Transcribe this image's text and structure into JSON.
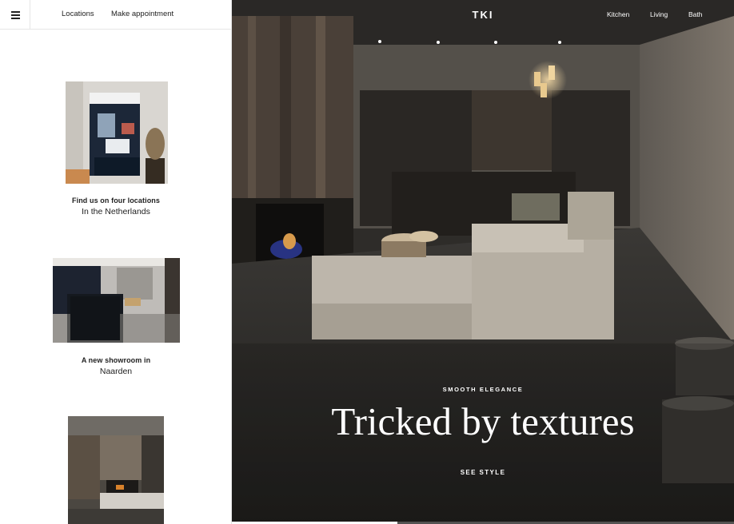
{
  "topbar": {
    "menu_icon": "hamburger-menu-icon",
    "links": [
      "Locations",
      "Make appointment"
    ]
  },
  "cards": [
    {
      "title": "Find us on four locations",
      "subtitle": "In the Netherlands"
    },
    {
      "title": "A new showroom in",
      "subtitle": "Naarden"
    }
  ],
  "hero": {
    "logo": "TKI",
    "nav": [
      "Kitchen",
      "Living",
      "Bath"
    ],
    "kicker": "SMOOTH ELEGANCE",
    "headline": "Tricked by textures",
    "cta": "SEE STYLE",
    "slide_progress": 0.33
  },
  "colors": {
    "accent_text": "#ffffff",
    "hero_dark": "#2c2a27",
    "panel_bg": "#ffffff"
  }
}
